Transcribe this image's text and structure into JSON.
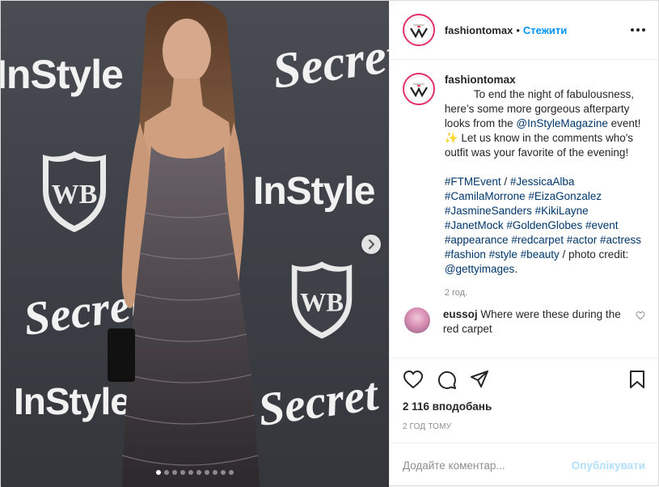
{
  "media": {
    "backdrop_text": {
      "instyle": "InStyle",
      "secret": "Secret"
    },
    "carousel": {
      "count": 10,
      "active_index": 0
    }
  },
  "header": {
    "username": "fashiontomax",
    "separator": "•",
    "follow_label": "Стежити"
  },
  "caption": {
    "username": "fashiontomax",
    "text_1": "To end the night of fabulousness, here’s some more gorgeous afterparty looks from the ",
    "mention_1": "@InStyleMagazine",
    "text_2": " event! ✨ Let us know in the comments who's outfit was your favorite of the evening!",
    "hashtags": [
      "#FTMEvent",
      "#JessicaAlba",
      "#CamilaMorrone",
      "#EizaGonzalez",
      "#JasmineSanders",
      "#KikiLayne",
      "#JanetMock",
      "#GoldenGlobes",
      "#event",
      "#appearance",
      "#redcarpet",
      "#actor",
      "#actress",
      "#fashion",
      "#style",
      "#beauty"
    ],
    "slash": " / ",
    "credit_text": "photo credit: ",
    "credit_mention": "@gettyimages",
    "credit_end": ".",
    "time": "2 год."
  },
  "comment": {
    "username": "eussoj",
    "text": "Where were these during the red carpet"
  },
  "actions": {
    "likes": "2 116 вподобань",
    "posted": "2 ГОД ТОМУ"
  },
  "add_comment": {
    "placeholder": "Додайте коментар...",
    "publish_label": "Опублікувати"
  },
  "colors": {
    "follow": "#0095f6",
    "link": "#00376b",
    "publish_disabled": "#b2dffc",
    "avatar_ring": "#e1306c"
  }
}
